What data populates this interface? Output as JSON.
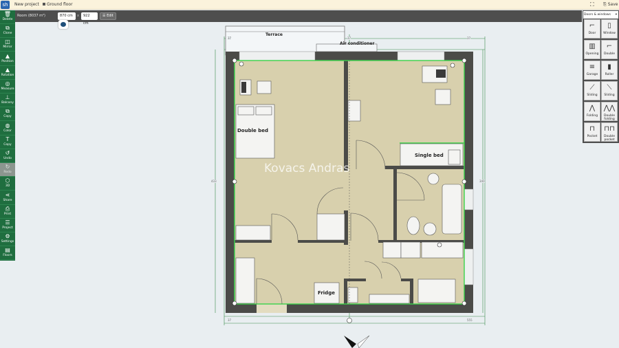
{
  "topbar": {
    "logo": "sh",
    "project": "New project",
    "floor": "Ground floor",
    "fullscreen_icon": "fullscreen-icon",
    "save": "Save"
  },
  "subbar": {
    "room_label": "Room (8037 m²)",
    "width": "870 cm",
    "sep": "x",
    "depth": "922 cm",
    "edit": "Edit"
  },
  "left_toolbar": [
    {
      "label": "Delete",
      "icon": "trash-icon",
      "glyph": "🗑"
    },
    {
      "label": "Clone",
      "icon": "clone-icon",
      "glyph": "⧉"
    },
    {
      "label": "Mirror",
      "icon": "mirror-icon",
      "glyph": "◫"
    },
    {
      "label": "Position",
      "icon": "position-icon",
      "glyph": "▲"
    },
    {
      "label": "Rotation",
      "icon": "rotation-icon",
      "glyph": "▲"
    },
    {
      "label": "Measure",
      "icon": "measure-icon",
      "glyph": "◎"
    },
    {
      "label": "Balcony",
      "icon": "balcony-icon",
      "glyph": "⊥"
    },
    {
      "label": "Copy",
      "icon": "copy-icon",
      "glyph": "⧉"
    },
    {
      "label": "Color",
      "icon": "color-icon",
      "glyph": "◍"
    },
    {
      "label": "Copy",
      "icon": "copy-style-icon",
      "glyph": "T"
    },
    {
      "label": "Undo",
      "icon": "undo-icon",
      "glyph": "↺"
    },
    {
      "label": "Redo",
      "icon": "redo-icon",
      "glyph": "↻",
      "disabled": true
    },
    {
      "label": "3D",
      "icon": "3d-icon",
      "glyph": "⬡"
    },
    {
      "label": "Share",
      "icon": "share-icon",
      "glyph": "⋖"
    },
    {
      "label": "Print",
      "icon": "print-icon",
      "glyph": "⎙"
    },
    {
      "label": "Project",
      "icon": "project-icon",
      "glyph": "☰"
    },
    {
      "label": "Settings",
      "icon": "settings-icon",
      "glyph": "⚙"
    },
    {
      "label": "Floors",
      "icon": "floors-icon",
      "glyph": "▤"
    }
  ],
  "right_panel": {
    "dropdown": "Doors & windows",
    "items": [
      {
        "label": "Door",
        "glyph": "⌐"
      },
      {
        "label": "Window",
        "glyph": "▯"
      },
      {
        "label": "Opening",
        "glyph": "▥"
      },
      {
        "label": "Double",
        "glyph": "⌐"
      },
      {
        "label": "Garage",
        "glyph": "≡"
      },
      {
        "label": "Roller",
        "glyph": "▮"
      },
      {
        "label": "Sliding",
        "glyph": "⟋"
      },
      {
        "label": "Sliding",
        "glyph": "⟍"
      },
      {
        "label": "Folding",
        "glyph": "⋀"
      },
      {
        "label": "Double folding",
        "glyph": "⋀⋀"
      },
      {
        "label": "Pocket",
        "glyph": "⊓"
      },
      {
        "label": "Double pocket",
        "glyph": "⊓⊓"
      }
    ]
  },
  "plan": {
    "terrace": "Terrace",
    "air_conditioner": "Air conditioner",
    "double_bed": "Double bed",
    "single_bed": "Single bed",
    "fridge": "Fridge",
    "watermark": "Kovacs Andras",
    "dims": {
      "d1": "37",
      "d2": "375",
      "d3": "37",
      "d4": "37",
      "d5": "555",
      "d6": "37",
      "d7": "433",
      "d8": "340"
    },
    "colors": {
      "floor": "#d8d0ad",
      "wall": "#4b4b48",
      "selection": "#39d34a"
    }
  }
}
